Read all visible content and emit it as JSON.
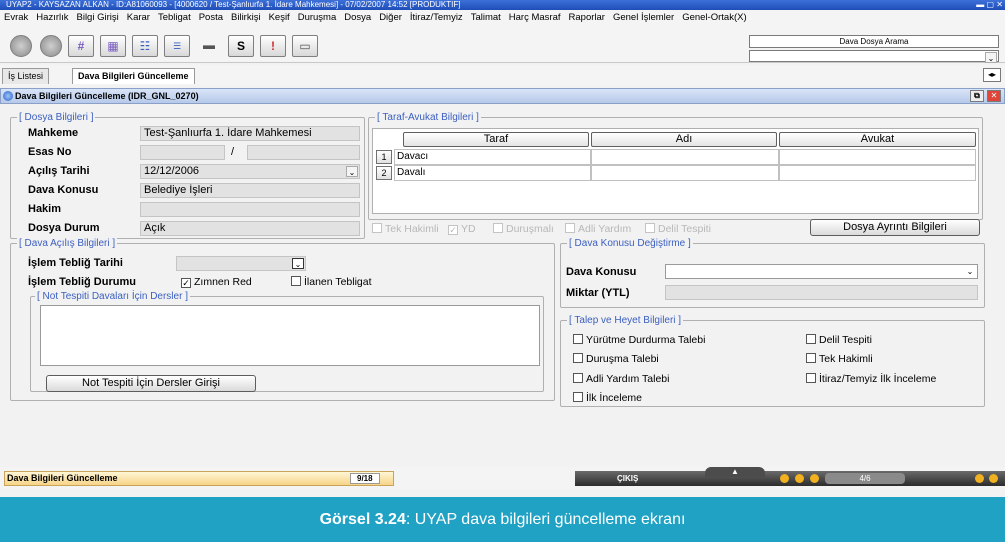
{
  "window": {
    "title": "UYAP2 - KAYSAZAN ALKAN - ID:A81060093 - [4000620 / Test-Şanlıurfa 1. İdare Mahkemesi] - 07/02/2007 14:52 [PRODUKTIF]"
  },
  "menu": [
    "Evrak",
    "Hazırlık",
    "Bilgi Girişi",
    "Karar",
    "Tebligat",
    "Posta",
    "Bilirkişi",
    "Keşif",
    "Duruşma",
    "Dosya",
    "Diğer",
    "İtiraz/Temyiz",
    "Talimat",
    "Harç Masraf",
    "Raporlar",
    "Genel İşlemler",
    "Genel-Ortak(X)"
  ],
  "toolbar": {
    "search_label": "Dava Dosya Arama"
  },
  "tabs": {
    "tab1": "İş Listesi",
    "tab2": "Dava Bilgileri Güncelleme"
  },
  "window_header": {
    "title": "Dava Bilgileri Güncelleme (IDR_GNL_0270)"
  },
  "dosya": {
    "group_label": "[ Dosya Bilgileri ]",
    "mahkeme_label": "Mahkeme",
    "mahkeme_value": "Test-Şanlıurfa 1. İdare Mahkemesi",
    "esas_label": "Esas No",
    "esas_sep": "/",
    "acilis_label": "Açılış Tarihi",
    "acilis_value": "12/12/2006",
    "konu_label": "Dava Konusu",
    "konu_value": "Belediye İşleri",
    "hakim_label": "Hakim",
    "durum_label": "Dosya Durum",
    "durum_value": "Açık"
  },
  "taraf": {
    "group_label": "[ Taraf-Avukat Bilgileri ]",
    "headers": [
      "Taraf",
      "Adı",
      "Avukat"
    ],
    "rows": [
      {
        "num": "1",
        "taraf": "Davacı"
      },
      {
        "num": "2",
        "taraf": "Davalı"
      }
    ]
  },
  "options": {
    "tek_hakimli": "Tek Hakimli",
    "yd": "YD",
    "durusmali": "Duruşmalı",
    "adli_yardim": "Adli Yardım",
    "delil_tespiti": "Delil Tespiti",
    "detail_button": "Dosya Ayrıntı Bilgileri"
  },
  "acilis": {
    "group_label": "[ Dava Açılış Bilgileri ]",
    "tebliğ_tarihi_label": "İşlem Tebliğ Tarihi",
    "tebliğ_durumu_label": "İşlem Tebliğ Durumu",
    "zimnen_red": "Zımnen Red",
    "ilanen_tebligat": "İlanen Tebligat",
    "not_tespiti_label": "[ Not Tespiti Davaları İçin Dersler ]",
    "ders_button": "Not Tespiti İçin Dersler Girişi"
  },
  "konu_degistirme": {
    "group_label": "[ Dava Konusu Değiştirme ]",
    "konu_label": "Dava Konusu",
    "miktar_label": "Miktar (YTL)"
  },
  "talep": {
    "group_label": "[ Talep ve Heyet Bilgileri ]",
    "yurutme": "Yürütme Durdurma Talebi",
    "durusma": "Duruşma Talebi",
    "adli_yardim": "Adli Yardım Talebi",
    "ilk_inceleme": "İlk İnceleme",
    "delil": "Delil Tespiti",
    "tek_hakimli": "Tek Hakimli",
    "itiraz": "İtiraz/Temyiz İlk İnceleme"
  },
  "status": {
    "left_label": "Dava Bilgileri Güncelleme",
    "page": "9/18",
    "exit": "ÇIKIŞ",
    "pager": "4/6"
  },
  "caption": {
    "bold": "Görsel 3.24",
    "text": ": UYAP dava bilgileri güncelleme ekranı"
  },
  "colors": {
    "caption_bg": "#1fa2c4",
    "group_label": "#3b5fc0",
    "titlebar": "#1f4db8"
  }
}
